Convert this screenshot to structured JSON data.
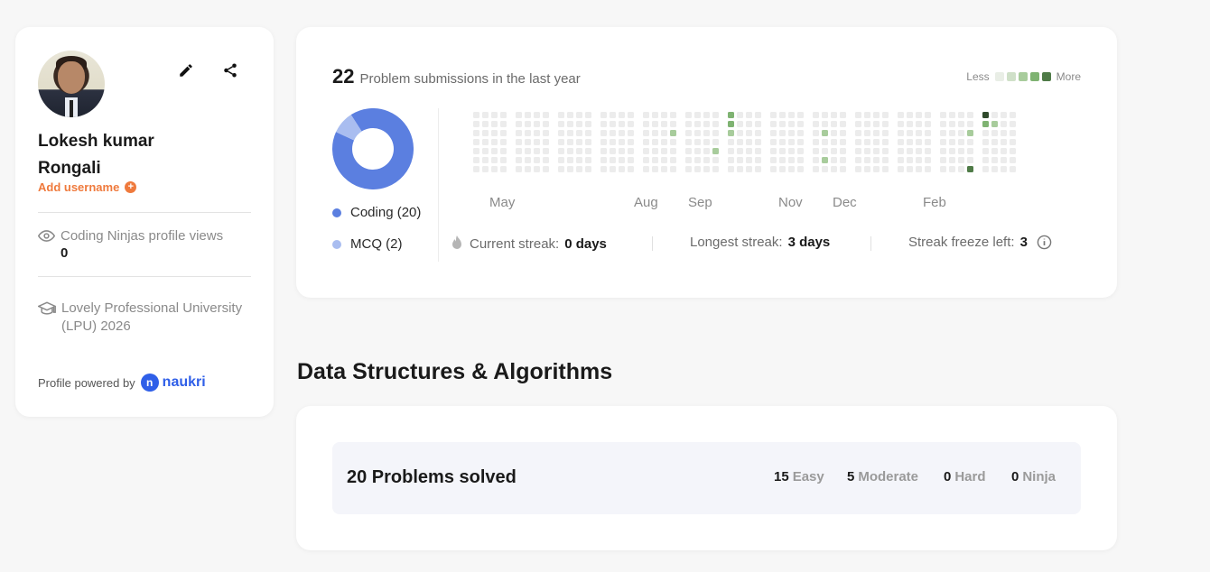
{
  "profile": {
    "name": "Lokesh kumar Rongali",
    "add_username": "Add username",
    "views_label": "Coding Ninjas profile views",
    "views_value": "0",
    "education": "Lovely Professional University (LPU) 2026",
    "powered_by": "Profile powered by",
    "naukri": "naukri"
  },
  "activity": {
    "submission_count": "22",
    "submission_label": "Problem submissions in the last year",
    "legend_less": "Less",
    "legend_more": "More",
    "legend_colors": [
      "#e9eee6",
      "#cfe0c8",
      "#a8cc9c",
      "#7fb372",
      "#4f7b47"
    ],
    "breakdown": [
      {
        "label": "Coding (20)",
        "value": 20,
        "color": "#5b7fe0"
      },
      {
        "label": "MCQ (2)",
        "value": 2,
        "color": "#a9bdf0"
      }
    ],
    "months": [
      "May",
      "Aug",
      "Sep",
      "Nov",
      "Dec",
      "Feb"
    ],
    "streak": {
      "current_label": "Current streak:",
      "current_value": "0 days",
      "longest_label": "Longest streak:",
      "longest_value": "3 days",
      "freeze_label": "Streak freeze left:",
      "freeze_value": "3"
    }
  },
  "dsa": {
    "section_title": "Data Structures & Algorithms",
    "solved_title": "20 Problems solved",
    "difficulties": [
      {
        "count": "15",
        "label": "Easy"
      },
      {
        "count": "5",
        "label": "Moderate"
      },
      {
        "count": "0",
        "label": "Hard"
      },
      {
        "count": "0",
        "label": "Ninja"
      }
    ]
  }
}
